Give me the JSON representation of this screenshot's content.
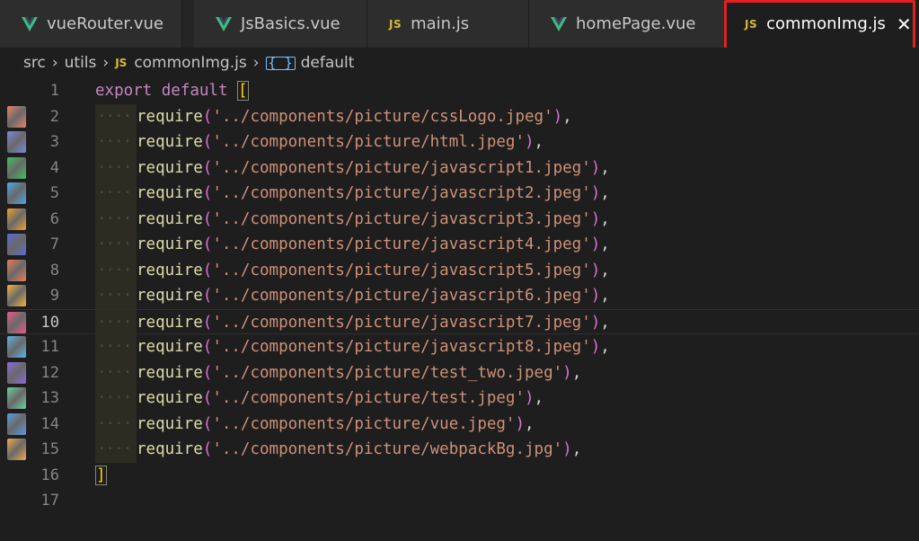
{
  "tabs": [
    {
      "name": "vueRouter.vue",
      "icon": "vue-icon",
      "active": false
    },
    {
      "name": "JsBasics.vue",
      "icon": "vue-icon",
      "active": false
    },
    {
      "name": "main.js",
      "icon": "js-icon",
      "active": false
    },
    {
      "name": "homePage.vue",
      "icon": "vue-icon",
      "active": false
    },
    {
      "name": "commonImg.js",
      "icon": "js-icon",
      "active": true
    }
  ],
  "js_icon_text": "JS",
  "close_glyph": "✕",
  "breadcrumb": {
    "src": "src",
    "utils": "utils",
    "file": "commonImg.js",
    "symbol": "default",
    "symbol_icon": "module-symbol-icon"
  },
  "editor": {
    "current_line": 10,
    "lines": [
      {
        "num": "1",
        "prefix": "export default ",
        "open": "[",
        "path": "",
        "close": ""
      },
      {
        "num": "2",
        "path": "'../components/picture/cssLogo.jpeg'"
      },
      {
        "num": "3",
        "path": "'../components/picture/html.jpeg'"
      },
      {
        "num": "4",
        "path": "'../components/picture/javascript1.jpeg'"
      },
      {
        "num": "5",
        "path": "'../components/picture/javascript2.jpeg'"
      },
      {
        "num": "6",
        "path": "'../components/picture/javascript3.jpeg'"
      },
      {
        "num": "7",
        "path": "'../components/picture/javascript4.jpeg'"
      },
      {
        "num": "8",
        "path": "'../components/picture/javascript5.jpeg'"
      },
      {
        "num": "9",
        "path": "'../components/picture/javascript6.jpeg'"
      },
      {
        "num": "10",
        "path": "'../components/picture/javascript7.jpeg'"
      },
      {
        "num": "11",
        "path": "'../components/picture/javascript8.jpeg'"
      },
      {
        "num": "12",
        "path": "'../components/picture/test_two.jpeg'"
      },
      {
        "num": "13",
        "path": "'../components/picture/test.jpeg'"
      },
      {
        "num": "14",
        "path": "'../components/picture/vue.jpeg'"
      },
      {
        "num": "15",
        "path": "'../components/picture/webpackBg.jpg'"
      },
      {
        "num": "16",
        "close": "]"
      },
      {
        "num": "17"
      }
    ],
    "require_fn": "require",
    "paren_open": "(",
    "paren_close": ")",
    "comma": ","
  },
  "gutter_thumb_colors": [
    "#e8826a",
    "#7a86e0",
    "#3fc25a",
    "#4aa8e8",
    "#f0a030",
    "#5a6ad8",
    "#f07a55",
    "#f0b43c",
    "#e85a8a",
    "#5ab4e8",
    "#8a6ae0",
    "#6ad0a0",
    "#5a9ae8",
    "#f0a850"
  ],
  "colors": {
    "highlight_box": "#e02020",
    "js_badge": "#d7ba3a",
    "vue_green": "#41b883",
    "keyword": "#c586c0",
    "function": "#dcdcaa",
    "string": "#ce9178",
    "bracket_gold": "#ffd700",
    "bracket_orchid": "#da70d6"
  }
}
